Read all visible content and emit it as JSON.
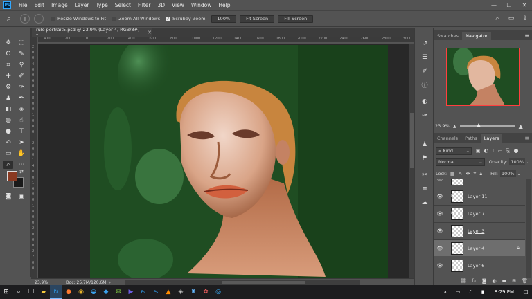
{
  "menu": [
    "File",
    "Edit",
    "Image",
    "Layer",
    "Type",
    "Select",
    "Filter",
    "3D",
    "View",
    "Window",
    "Help"
  ],
  "app_logo": "Ps",
  "window_controls": [
    "minimize-icon",
    "maximize-icon",
    "close-icon"
  ],
  "options": {
    "resize_windows": "Resize Windows to Fit",
    "zoom_all_windows": "Zoom All Windows",
    "scrubby_zoom": "Scrubby Zoom",
    "btn_100": "100%",
    "fit_screen": "Fit Screen",
    "fill_screen": "Fill Screen"
  },
  "document": {
    "tab_title": "rule portrait5.psd @ 23.9% (Layer 4, RGB/8#) *",
    "zoom": "23.9%",
    "doc_size": "Doc: 25.7M/120.6M"
  },
  "rulers": {
    "top": [
      "400",
      "200",
      "0",
      "200",
      "400",
      "600",
      "800",
      "1000",
      "1200",
      "1400",
      "1600",
      "1800",
      "2000",
      "2200",
      "2400",
      "2600",
      "2800",
      "3000"
    ],
    "left": [
      "2",
      "0",
      "0",
      "4",
      "0",
      "0",
      "6",
      "0",
      "0",
      "8",
      "0",
      "0",
      "1",
      "0",
      "0",
      "0",
      "1",
      "2",
      "0",
      "0",
      "1",
      "4",
      "0",
      "0",
      "1",
      "6",
      "0",
      "0",
      "1",
      "8",
      "0",
      "0",
      "2",
      "0",
      "0",
      "0",
      "2",
      "2",
      "0",
      "0"
    ]
  },
  "colors": {
    "foreground": "#8a3a22",
    "background": "#1a1a1a",
    "canvas_green": "#1f4d22",
    "selection_red": "#ff3f3f"
  },
  "navigator": {
    "tabs": [
      "Swatches",
      "Navigator"
    ],
    "zoom": "23.9%"
  },
  "layers_panel": {
    "tabs": [
      "Channels",
      "Paths",
      "Layers"
    ],
    "filter_kind": "Kind",
    "blend_mode": "Normal",
    "opacity_label": "Opacity:",
    "opacity": "100%",
    "lock_label": "Lock:",
    "fill_label": "Fill:",
    "fill": "100%",
    "layers": [
      {
        "name": "Layer 11"
      },
      {
        "name": "Layer 7"
      },
      {
        "name": "Layer 3"
      },
      {
        "name": "Layer 4"
      },
      {
        "name": "Layer 6"
      }
    ]
  },
  "taskbar": {
    "time": "8:29 PM"
  }
}
